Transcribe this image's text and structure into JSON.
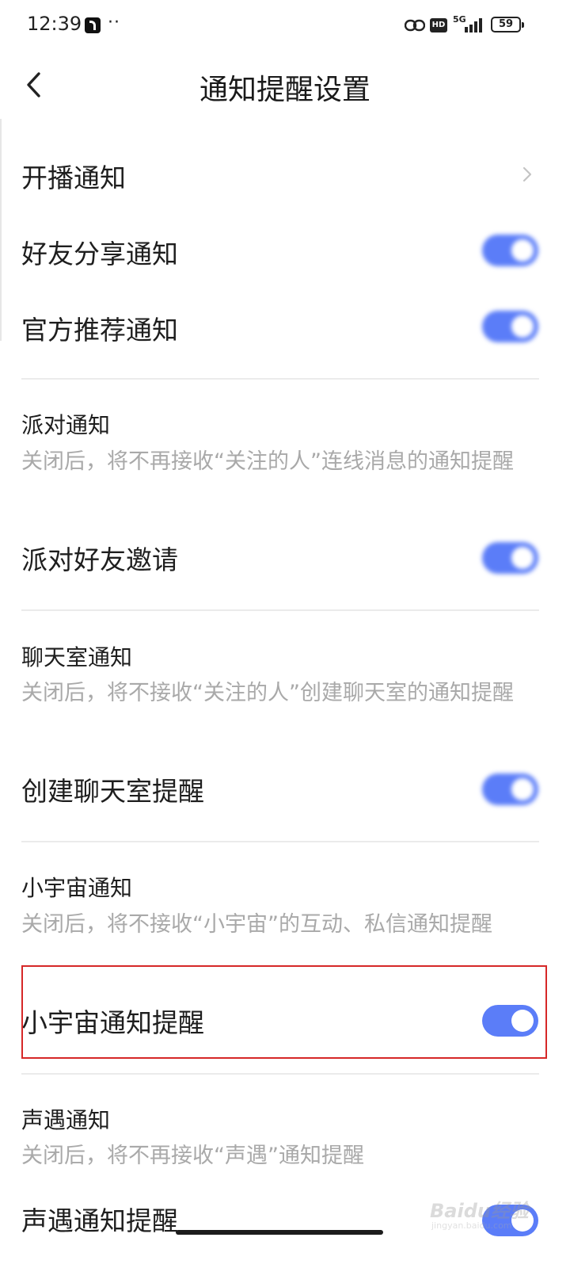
{
  "status_bar": {
    "time": "12:39",
    "dots": "··",
    "network": "5G",
    "hd_badge": "HD",
    "battery": "59"
  },
  "header": {
    "title": "通知提醒设置",
    "back_icon": "chevron-left-icon"
  },
  "settings": {
    "live_notify": {
      "label": "开播通知"
    },
    "friend_share": {
      "label": "好友分享通知",
      "enabled": true
    },
    "official_recommend": {
      "label": "官方推荐通知",
      "enabled": true
    },
    "party": {
      "heading": "派对通知",
      "description": "关闭后，将不再接收“关注的人”连线消息的通知提醒",
      "item_label": "派对好友邀请",
      "enabled": true
    },
    "chatroom": {
      "heading": "聊天室通知",
      "description": "关闭后，将不接收“关注的人”创建聊天室的通知提醒",
      "item_label": "创建聊天室提醒",
      "enabled": true
    },
    "universe": {
      "heading": "小宇宙通知",
      "description": "关闭后，将不接收“小宇宙”的互动、私信通知提醒",
      "item_label": "小宇宙通知提醒",
      "enabled": true
    },
    "voice_meet": {
      "heading": "声遇通知",
      "description": "关闭后，将不再接收“声遇”通知提醒",
      "item_label": "声遇通知提醒",
      "enabled": true
    }
  },
  "watermark": {
    "brand": "Baidu经验",
    "url": "jingyan.baidu.com"
  },
  "colors": {
    "accent": "#5b7df8",
    "highlight_border": "#d62828",
    "secondary_text": "#a9a9a9"
  }
}
